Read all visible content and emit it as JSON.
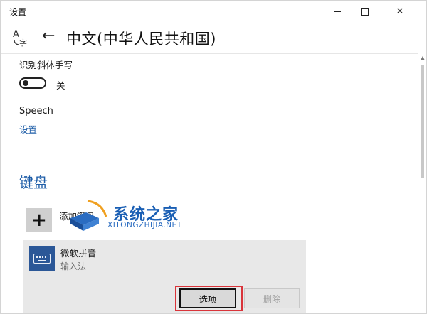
{
  "window": {
    "title": "设置",
    "controls": {
      "minimize": "minimize",
      "maximize": "maximize",
      "close": "close"
    }
  },
  "header": {
    "page_title": "中文(中华人民共和国)",
    "back_icon": "back-arrow-icon",
    "language_icon": "language-icon"
  },
  "handwriting": {
    "label": "识别斜体手写",
    "toggle_state_label": "关",
    "toggle_on": false
  },
  "speech": {
    "label": "Speech",
    "settings_link": "设置"
  },
  "keyboard_section": {
    "heading": "键盘",
    "add_keyboard_label": "添加键盘",
    "add_icon_glyph": "+",
    "items": [
      {
        "name": "微软拼音",
        "type": "输入法",
        "icon": "keyboard-icon"
      }
    ],
    "options_button": "选项",
    "delete_button": "删除"
  },
  "watermark": {
    "text": "系统之家",
    "subtext": "XITONGZHIJIA.NET"
  },
  "colors": {
    "accent": "#1f5ea8",
    "keyboard_icon_bg": "#2b5797",
    "highlight": "#d9343a",
    "panel_bg": "#e8e8e8"
  }
}
